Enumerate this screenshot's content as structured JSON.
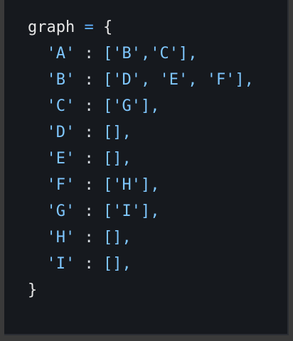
{
  "code": {
    "lines": [
      [
        "graph",
        " = ",
        "{"
      ],
      [
        "'A'",
        " : ",
        "['B','C'],"
      ],
      [
        "'B'",
        " : ",
        "['D', 'E', 'F'],"
      ],
      [
        "'C'",
        " : ",
        "['G'],"
      ],
      [
        "'D'",
        " : ",
        "[],"
      ],
      [
        "'E'",
        " : ",
        "[],"
      ],
      [
        "'F'",
        " : ",
        "['H'],"
      ],
      [
        "'G'",
        " : ",
        "['I'],"
      ],
      [
        "'H'",
        " : ",
        "[],"
      ],
      [
        "'I'",
        " : ",
        "[],"
      ],
      [
        "}",
        "",
        ""
      ]
    ]
  }
}
